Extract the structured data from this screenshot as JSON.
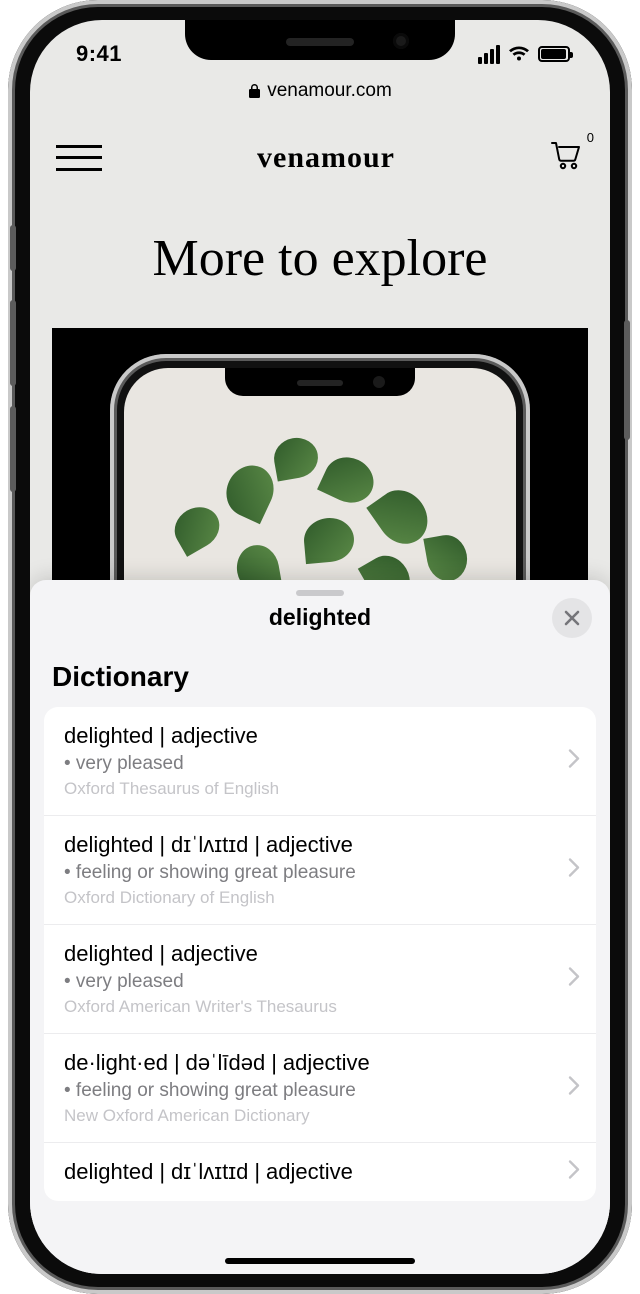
{
  "statusbar": {
    "time": "9:41"
  },
  "browser": {
    "domain": "venamour.com"
  },
  "site": {
    "brand": "venamour",
    "cart_count": "0",
    "hero_title": "More to explore"
  },
  "lookup": {
    "word": "delighted",
    "section_title": "Dictionary",
    "entries": [
      {
        "word": "delighted",
        "phonetic": "",
        "pos": "adjective",
        "definition": "very pleased",
        "source": "Oxford Thesaurus of English"
      },
      {
        "word": "delighted",
        "phonetic": "dɪˈlʌɪtɪd",
        "pos": "adjective",
        "definition": "feeling or showing great pleasure",
        "source": "Oxford Dictionary of English"
      },
      {
        "word": "delighted",
        "phonetic": "",
        "pos": "adjective",
        "definition": "very pleased",
        "source": "Oxford American Writer's Thesaurus"
      },
      {
        "word": "de·light·ed",
        "phonetic": "dəˈlīdəd",
        "pos": "adjective",
        "definition": "feeling or showing great pleasure",
        "source": "New Oxford American Dictionary"
      },
      {
        "word": "delighted",
        "phonetic": "dɪˈlʌɪtɪd",
        "pos": "adjective",
        "definition": "",
        "source": ""
      }
    ]
  }
}
